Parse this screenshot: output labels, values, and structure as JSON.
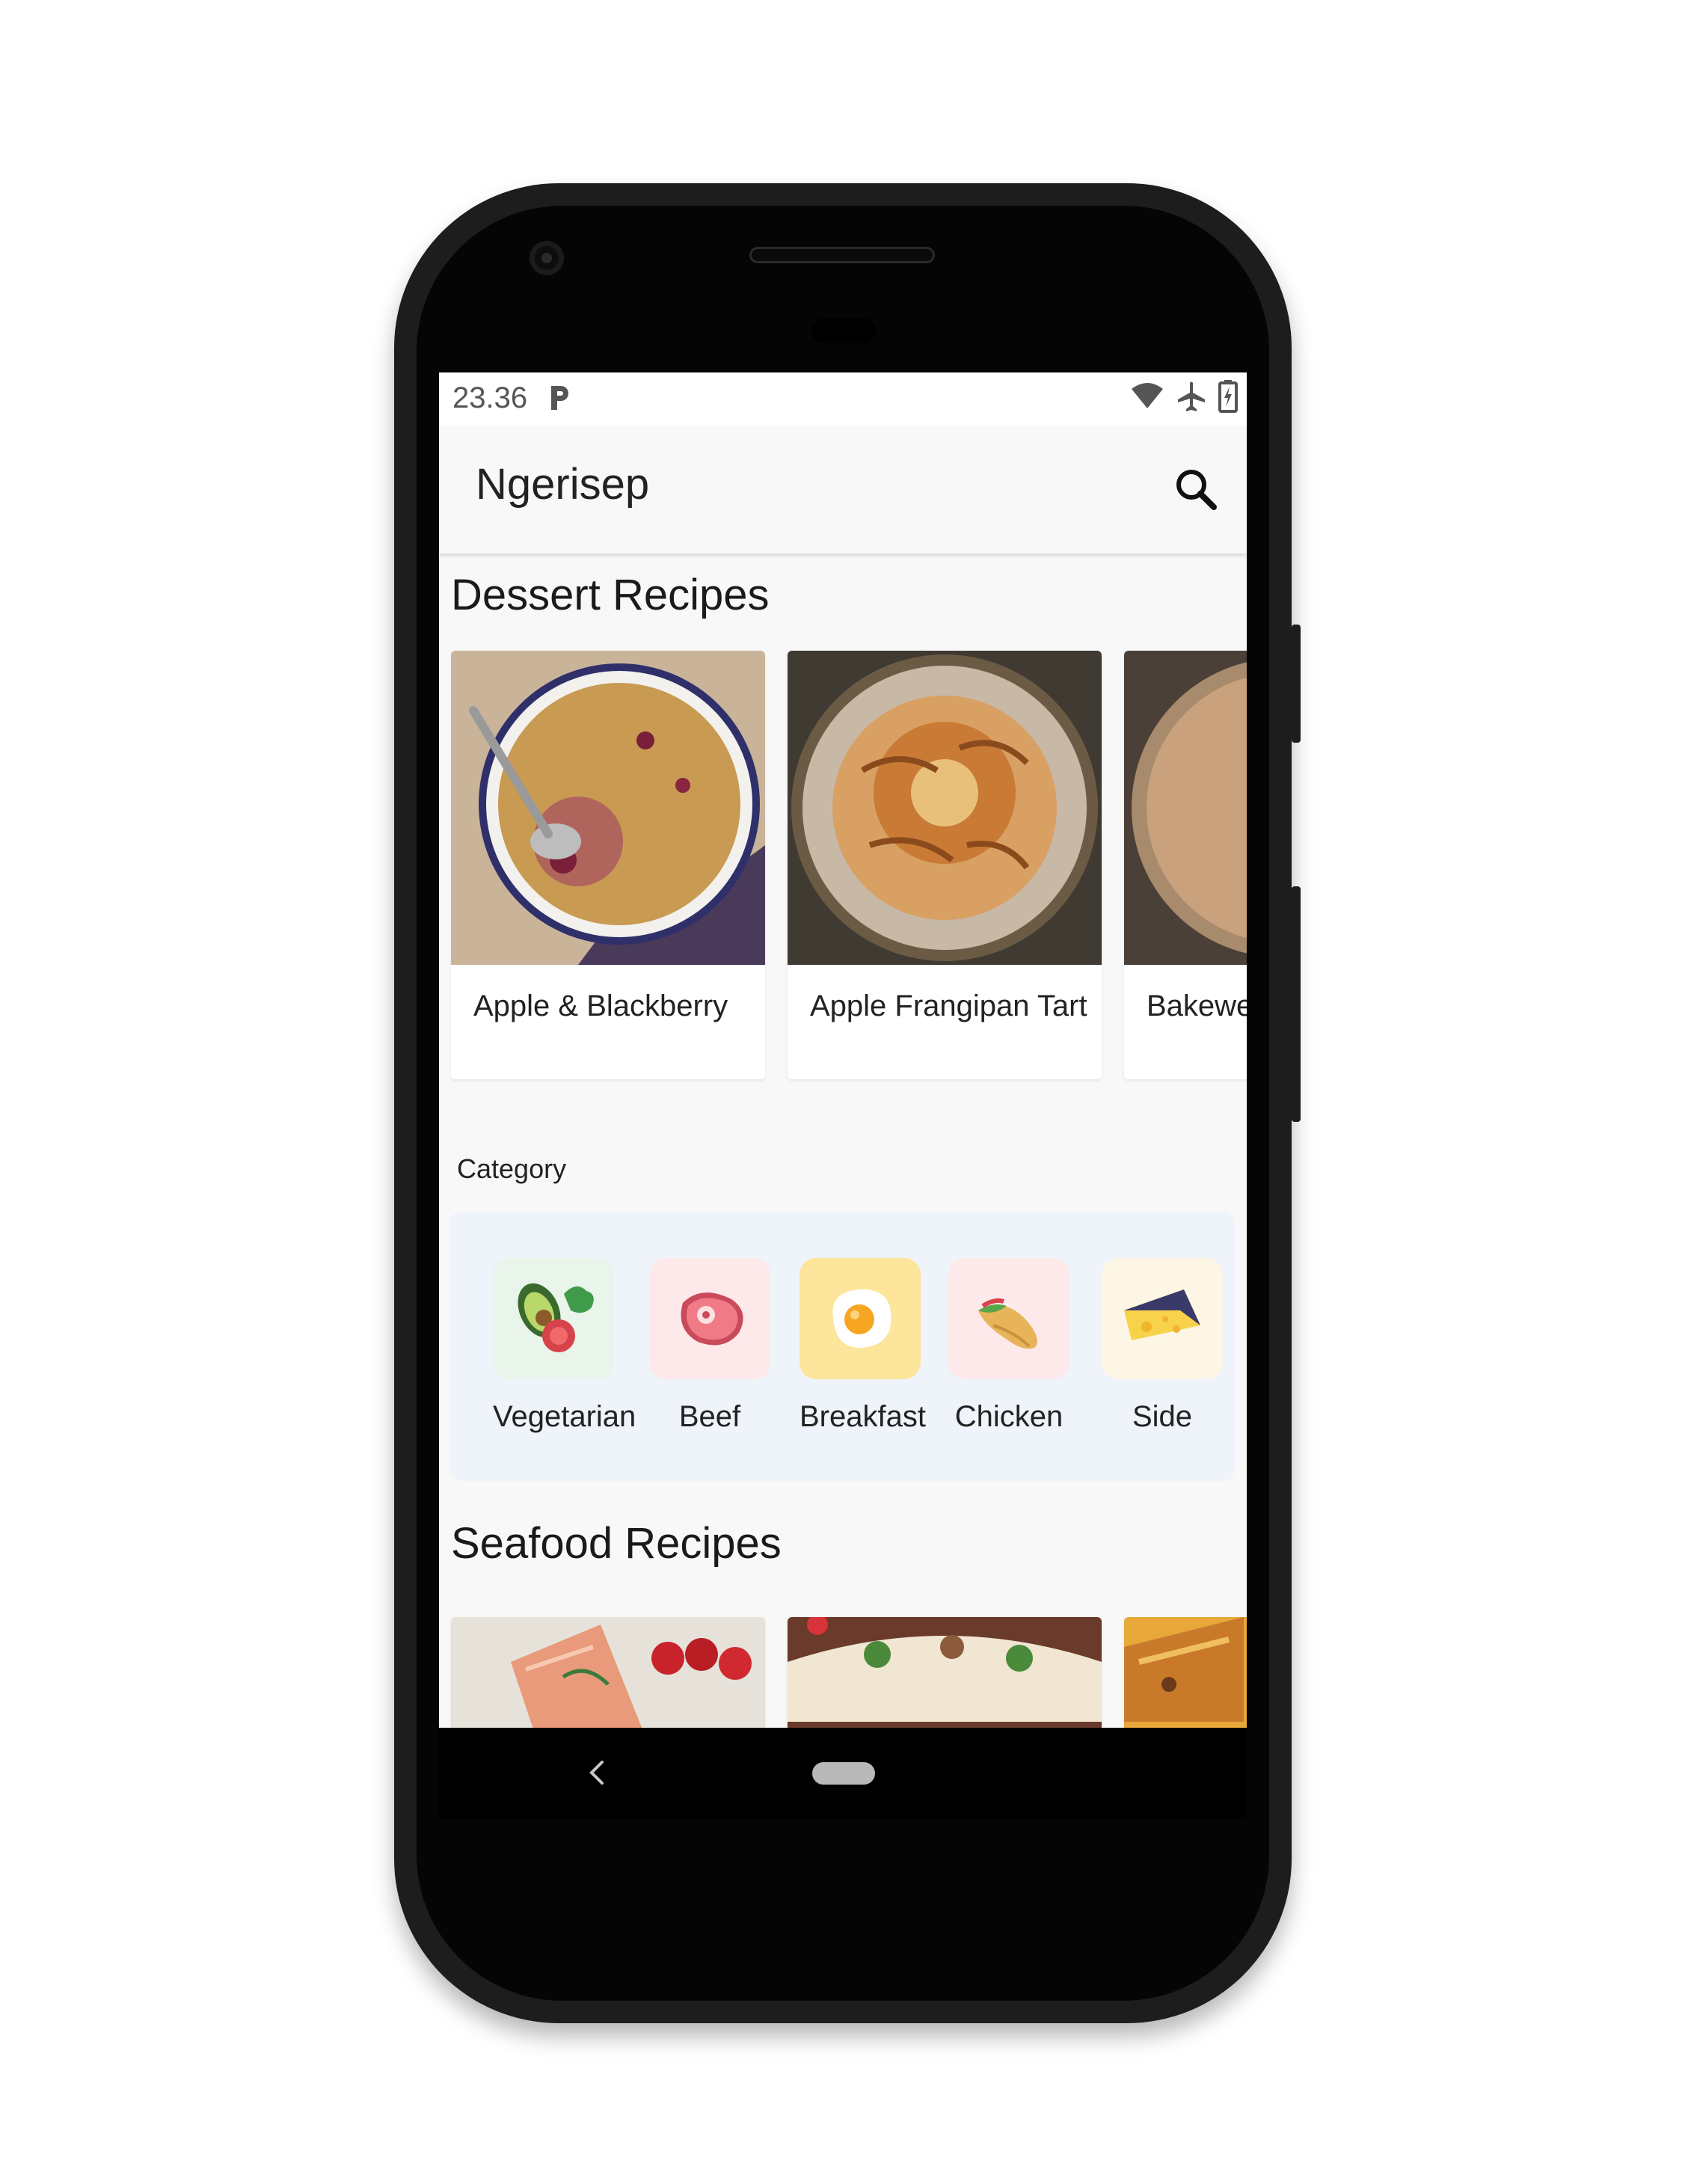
{
  "status_bar": {
    "time": "23.36"
  },
  "app_bar": {
    "title": "Ngerisep"
  },
  "dessert_section": {
    "title": "Dessert Recipes",
    "recipes": [
      {
        "name": "Apple & Blackberry"
      },
      {
        "name": "Apple Frangipan Tart"
      },
      {
        "name": "Bakewe"
      }
    ]
  },
  "category_section": {
    "title": "Category",
    "items": [
      {
        "label": "Vegetarian",
        "icon": "vegetables-icon",
        "tile_color": "#e9f4ea"
      },
      {
        "label": "Beef",
        "icon": "steak-icon",
        "tile_color": "#fde9ea"
      },
      {
        "label": "Breakfast",
        "icon": "fried-egg-icon",
        "tile_color": "#fde59c"
      },
      {
        "label": "Chicken",
        "icon": "wrap-icon",
        "tile_color": "#fde9ea"
      },
      {
        "label": "Side",
        "icon": "cheese-icon",
        "tile_color": "#fdf6e5"
      }
    ]
  },
  "seafood_section": {
    "title": "Seafood Recipes"
  },
  "colors": {
    "accent_tile": "#fde59c",
    "panel_bg": "#eff3fa",
    "page_bg": "#f8f8f8"
  }
}
